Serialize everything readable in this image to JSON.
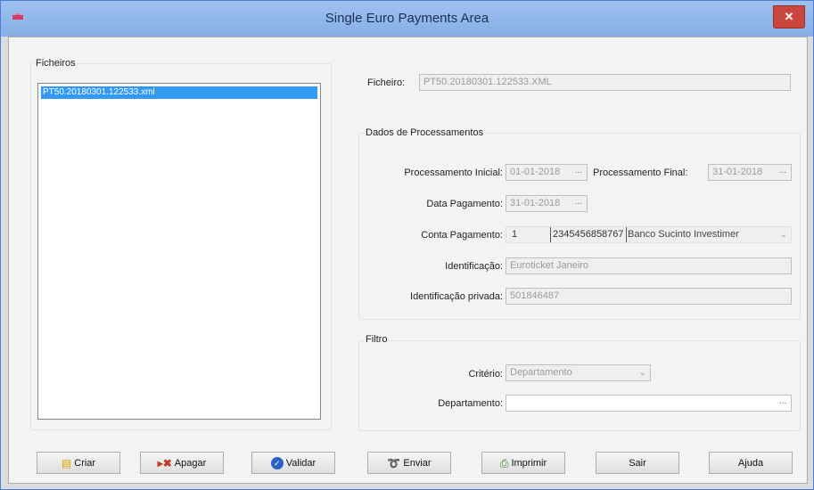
{
  "window": {
    "title": "Single Euro Payments Area",
    "close_label": "✕"
  },
  "ficheiros": {
    "group_label": "Ficheiros",
    "items": [
      "PT50.20180301.122533.xml"
    ]
  },
  "ficheiro": {
    "label": "Ficheiro:",
    "value": "PT50.20180301.122533.XML"
  },
  "dados": {
    "group_label": "Dados de Processamentos",
    "proc_inicial_label": "Processamento Inicial:",
    "proc_inicial_value": "01-01-2018",
    "proc_final_label": "Processamento Final:",
    "proc_final_value": "31-01-2018",
    "data_pag_label": "Data Pagamento:",
    "data_pag_value": "31-01-2018",
    "conta_label": "Conta Pagamento:",
    "conta_num": "1",
    "conta_account": "2345456858767",
    "conta_bank": "Banco Sucinto Investimer",
    "ident_label": "Identificação:",
    "ident_value": "Euroticket Janeiro",
    "ident_priv_label": "Identificação privada:",
    "ident_priv_value": "501846487",
    "ellipsis": "..."
  },
  "filtro": {
    "group_label": "Filtro",
    "criterio_label": "Critério:",
    "criterio_value": "Departamento",
    "depto_label": "Departamento:",
    "depto_value": ""
  },
  "buttons": {
    "criar": "Criar",
    "apagar": "Apagar",
    "validar": "Validar",
    "enviar": "Enviar",
    "imprimir": "Imprimir",
    "sair": "Sair",
    "ajuda": "Ajuda"
  }
}
